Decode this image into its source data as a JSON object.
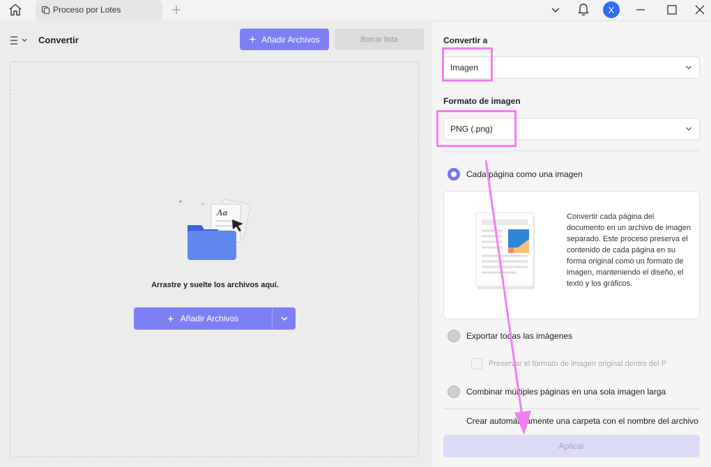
{
  "titlebar": {
    "tab_label": "Proceso por Lotes",
    "avatar_initial": "X"
  },
  "left": {
    "title": "Convertir",
    "add_files_label": "Añadir Archivos",
    "clear_list_label": "Borrar lista",
    "drop_text": "Arrastre y suelte los archivos aquí.",
    "add_files_main_label": "Añadir Archivos"
  },
  "right": {
    "convert_to_label": "Convertir a",
    "convert_to_value": "Imagen",
    "image_format_label": "Formato de imagen",
    "image_format_value": "PNG (.png)",
    "option_each_page": "Cada página como una imagen",
    "info_text": "Convertir cada página del documento en un archivo de imagen separado. Este proceso preserva el contenido de cada página en su forma original como un formato de imagen, manteniendo el diseño, el texto y los gráficos.",
    "option_export_images": "Exportar todas las imágenes",
    "preserve_format_label": "Preservar el formato de imagen original dentro del P",
    "option_combine": "Combinar múltiples páginas en una sola imagen larga",
    "auto_folder_label": "Crear automáticamente una carpeta con el nombre del archivo",
    "apply_label": "Aplicar"
  },
  "colors": {
    "accent": "#7f7ff5",
    "annotation": "#f27ff0",
    "radio_selected": "#7a75f2"
  }
}
